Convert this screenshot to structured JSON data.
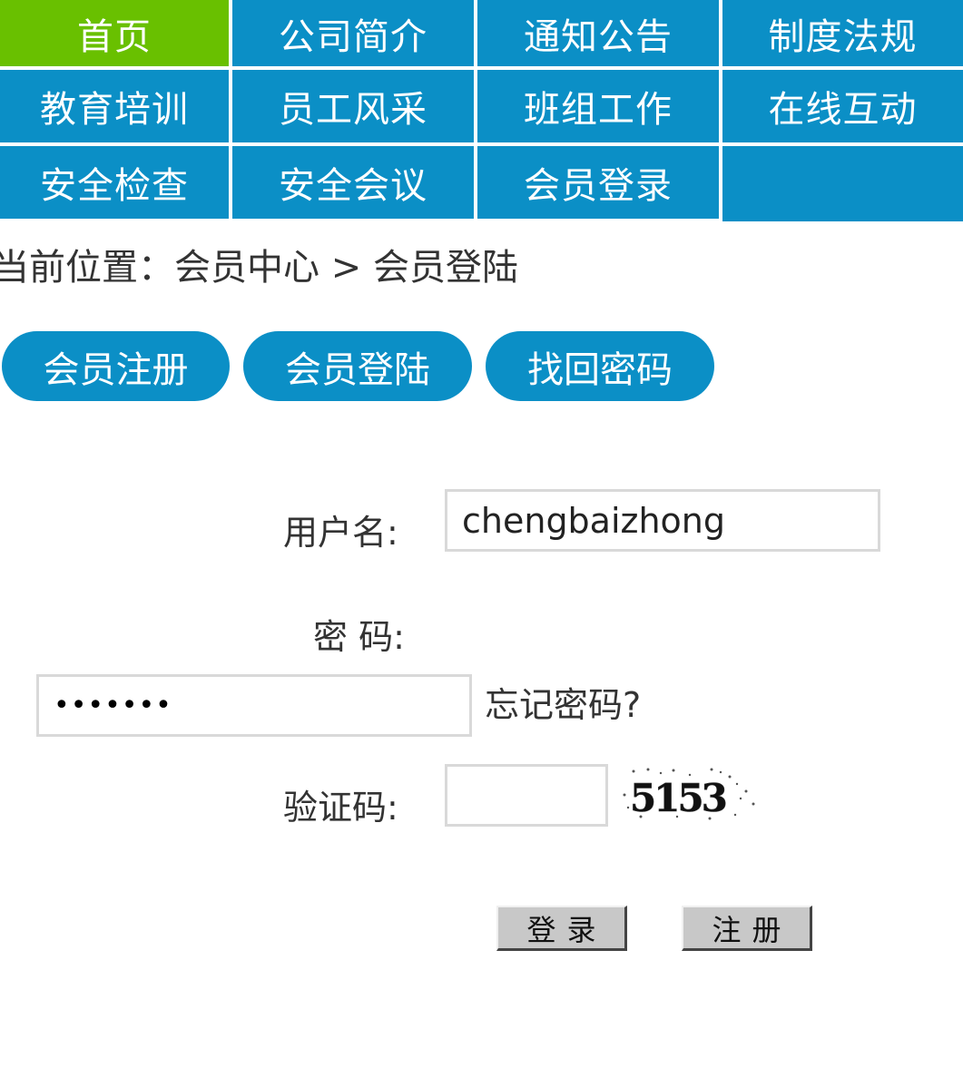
{
  "nav": {
    "items": [
      {
        "label": "首页",
        "active": true
      },
      {
        "label": "公司简介"
      },
      {
        "label": "通知公告"
      },
      {
        "label": "制度法规"
      },
      {
        "label": "教育培训"
      },
      {
        "label": "员工风采"
      },
      {
        "label": "班组工作"
      },
      {
        "label": "在线互动"
      },
      {
        "label": "安全检查"
      },
      {
        "label": "安全会议"
      },
      {
        "label": "会员登录"
      }
    ]
  },
  "breadcrumb": "当前位置：会员中心 > 会员登陆",
  "tabs": [
    {
      "label": "会员注册"
    },
    {
      "label": "会员登陆"
    },
    {
      "label": "找回密码"
    }
  ],
  "form": {
    "username_label": "用户名:",
    "username_value": "chengbaizhong",
    "password_label": "密 码:",
    "password_mask": "•••••••",
    "forgot_label": "忘记密码?",
    "captcha_label": "验证码:",
    "captcha_value": "",
    "captcha_text": "5153",
    "login_button": "登录",
    "register_button": "注册"
  },
  "colors": {
    "nav_blue": "#0b8fc6",
    "nav_active_green": "#69c000",
    "text": "#333333",
    "button_gray": "#c8c8c8"
  }
}
